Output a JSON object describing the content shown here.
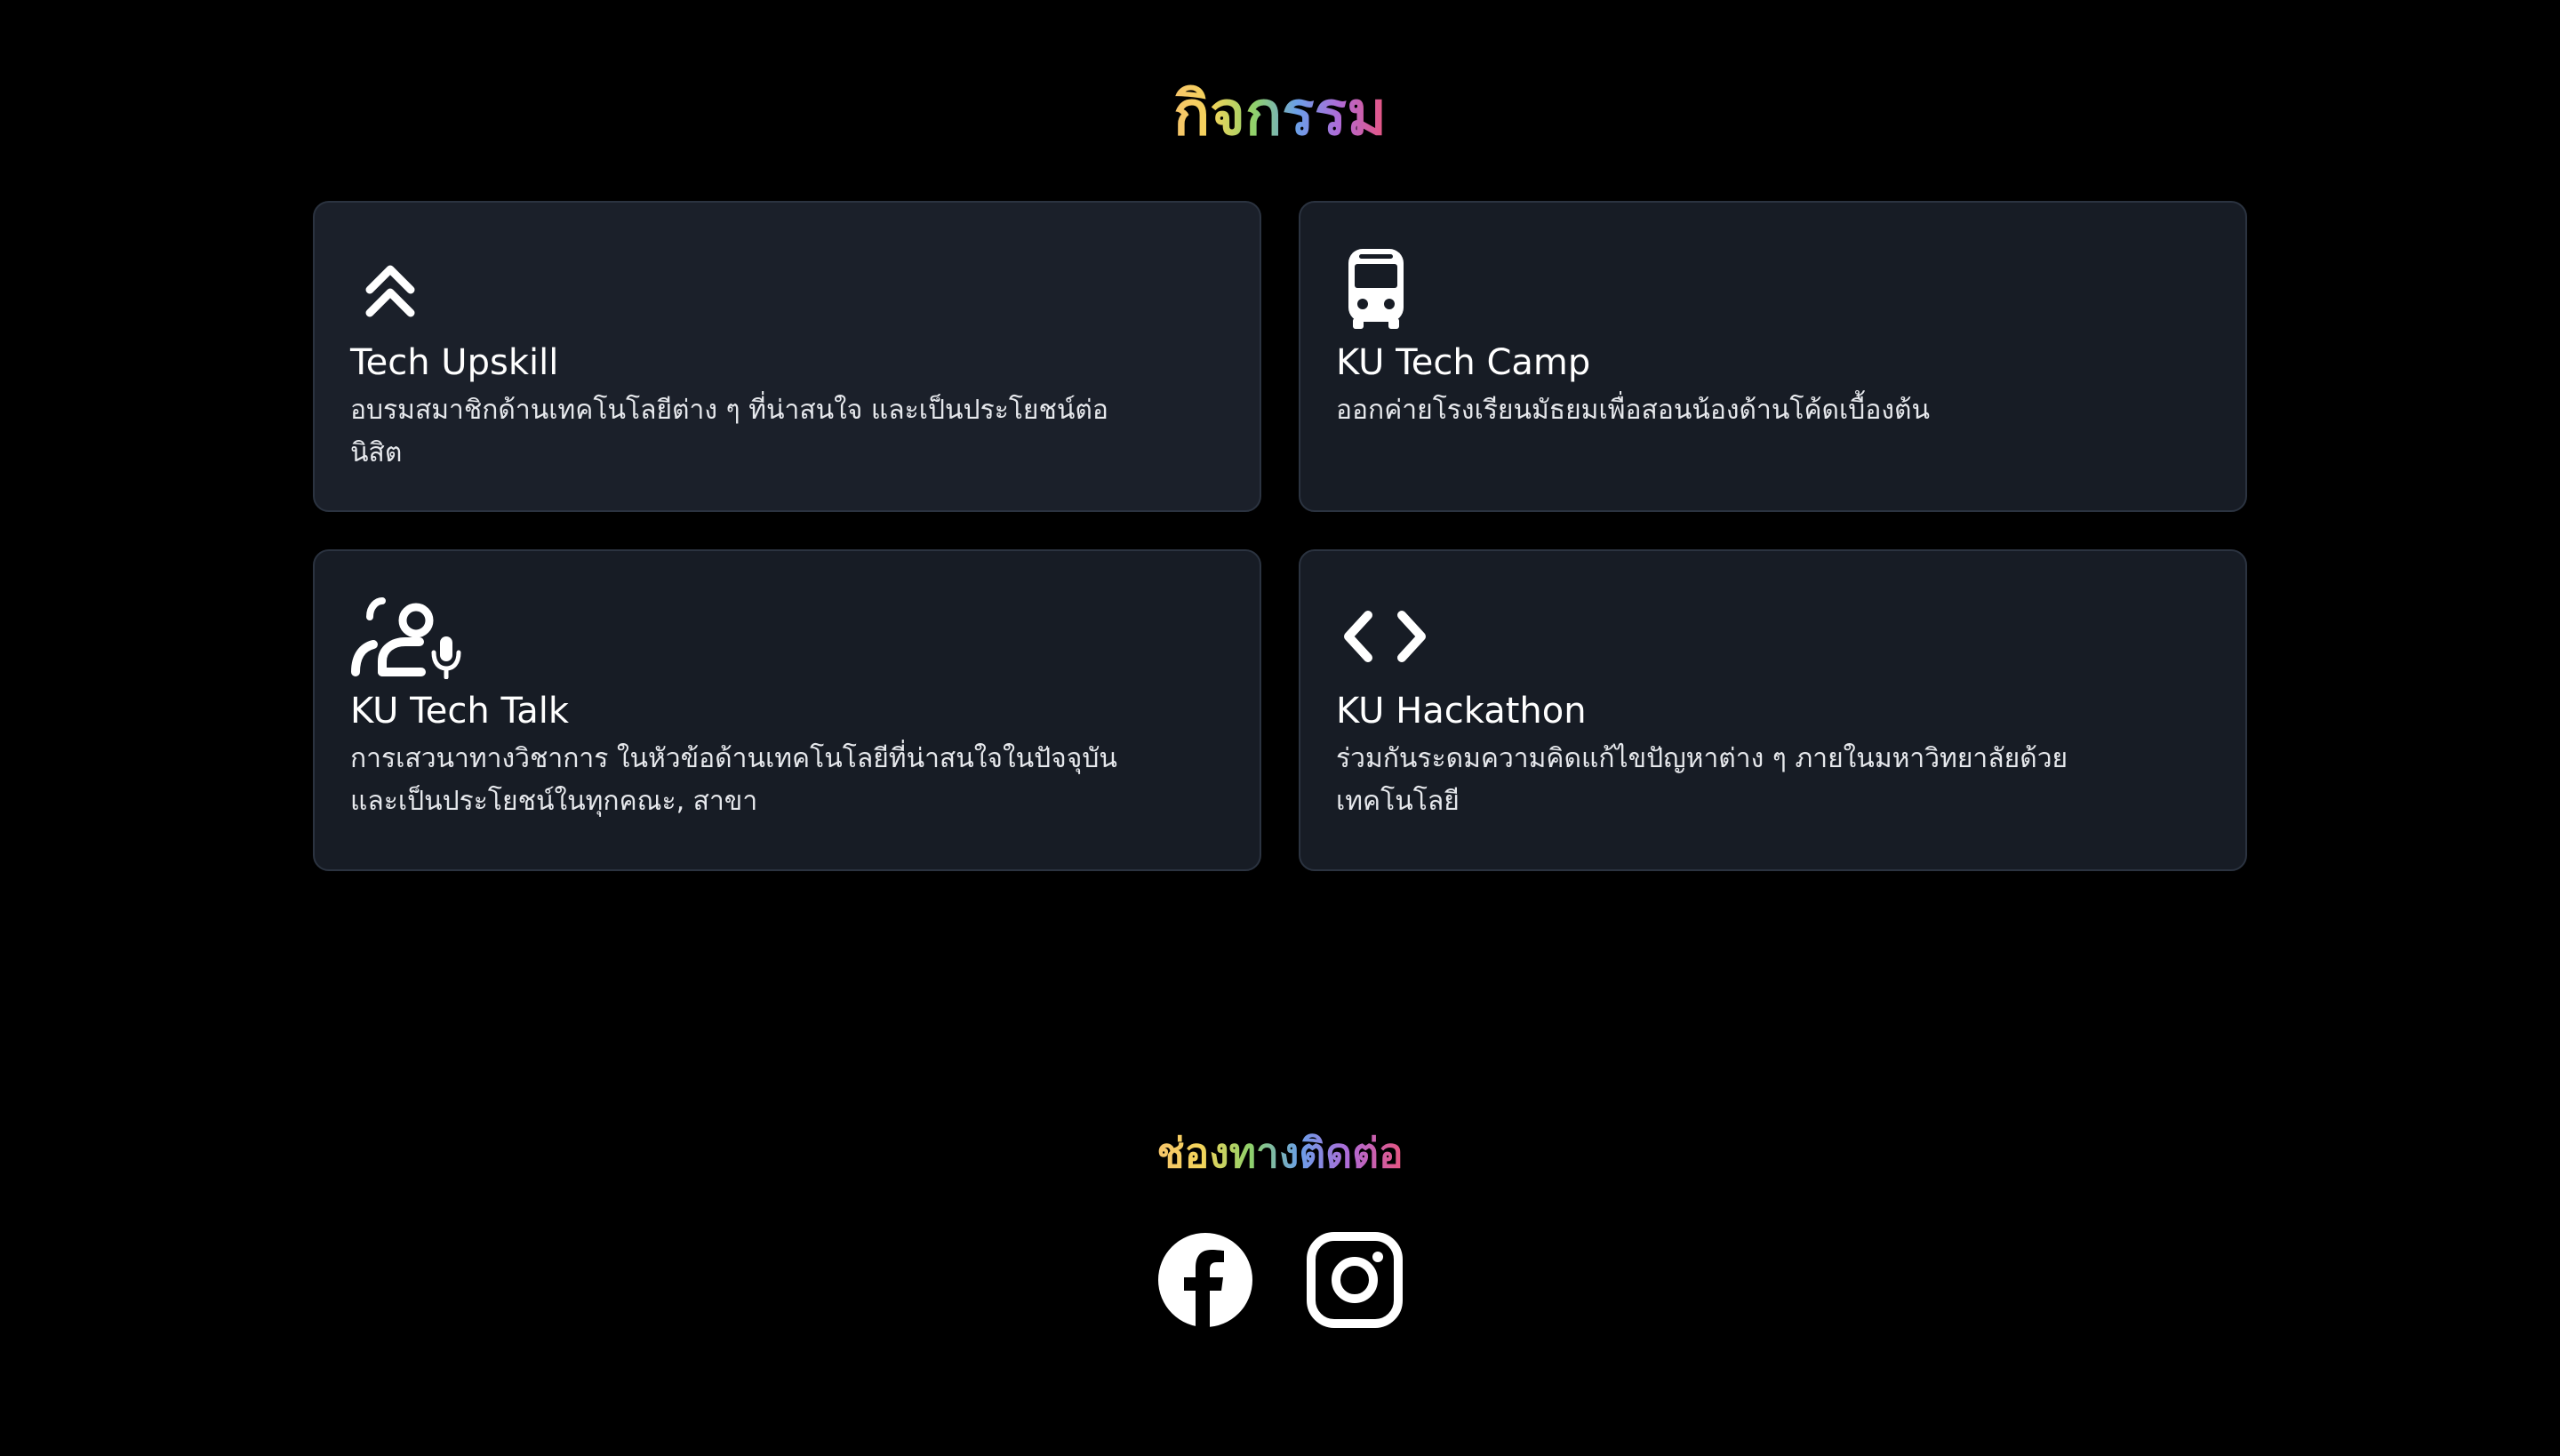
{
  "activities": {
    "title": "กิจกรรม",
    "cards": [
      {
        "icon": "double-chevron-up-icon",
        "title": "Tech Upskill",
        "description": "อบรมสมาชิกด้านเทคโนโลยีต่าง ๆ ที่น่าสนใจ และเป็นประโยชน์ต่อนิสิต"
      },
      {
        "icon": "bus-icon",
        "title": "KU Tech Camp",
        "description": "ออกค่ายโรงเรียนมัธยมเพื่อสอนน้องด้านโค้ดเบื้องต้น"
      },
      {
        "icon": "speaker-microphone-icon",
        "title": "KU Tech Talk",
        "description": "การเสวนาทางวิชาการ ในหัวข้อด้านเทคโนโลยีที่น่าสนใจในปัจจุบัน และเป็นประโยชน์ในทุกคณะ, สาขา"
      },
      {
        "icon": "code-brackets-icon",
        "title": "KU Hackathon",
        "description": "ร่วมกันระดมความคิดแก้ไขปัญหาต่าง ๆ ภายในมหาวิทยาลัยด้วยเทคโนโลยี"
      }
    ]
  },
  "contact": {
    "title": "ช่องทางติดต่อ",
    "links": [
      {
        "icon": "facebook-icon"
      },
      {
        "icon": "instagram-icon"
      }
    ]
  },
  "colors": {
    "background": "#000000",
    "card_background": "#1b202a",
    "card_border": "#2b3340",
    "gradient": [
      "#f7c56b",
      "#8fd16a",
      "#6b9fe8",
      "#b06ad6",
      "#e8557f"
    ]
  }
}
